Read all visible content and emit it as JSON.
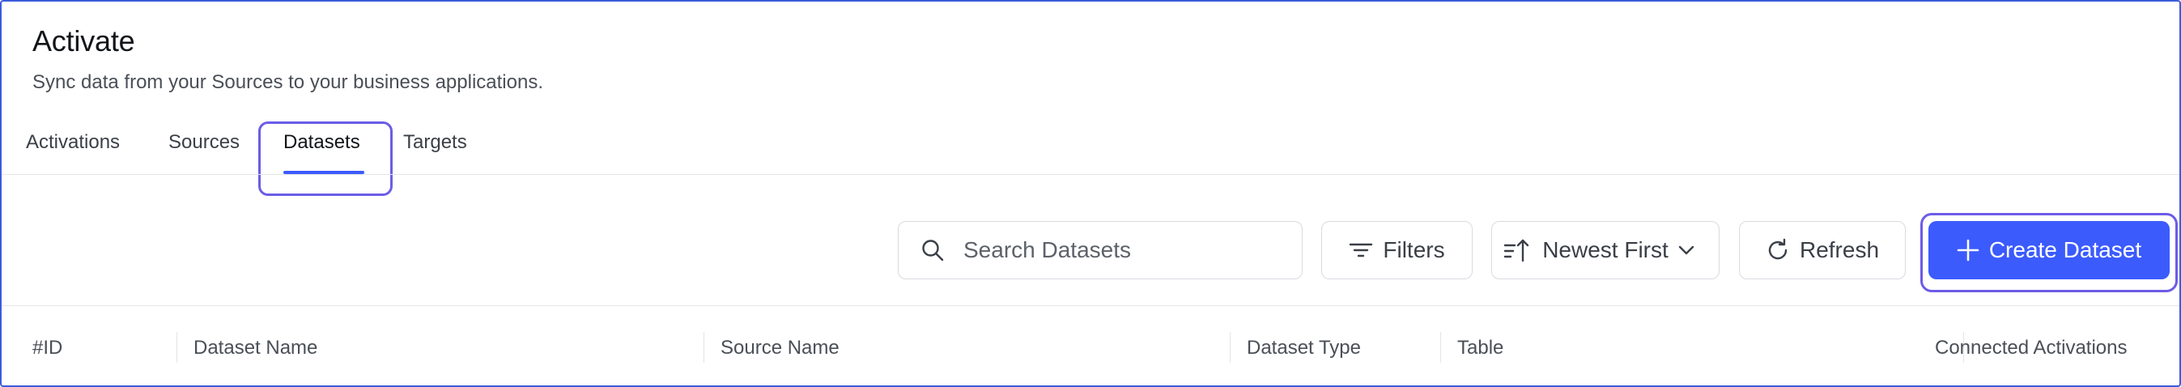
{
  "header": {
    "title": "Activate",
    "subtitle": "Sync data from your Sources to your business applications."
  },
  "tabs": [
    {
      "label": "Activations",
      "active": false
    },
    {
      "label": "Sources",
      "active": false
    },
    {
      "label": "Datasets",
      "active": true
    },
    {
      "label": "Targets",
      "active": false
    }
  ],
  "toolbar": {
    "search_placeholder": "Search Datasets",
    "filters_label": "Filters",
    "sort_label": "Newest First",
    "refresh_label": "Refresh",
    "create_label": "Create Dataset"
  },
  "table": {
    "columns": [
      "#ID",
      "Dataset Name",
      "Source Name",
      "Dataset Type",
      "Table",
      "Connected Activations"
    ]
  },
  "icons": {
    "search": "search-icon",
    "filters": "filter-lines-icon",
    "sort": "sort-arrow-icon",
    "chevron": "chevron-down-icon",
    "refresh": "refresh-icon",
    "create": "plus-icon"
  },
  "colors": {
    "accent": "#3b5bfd",
    "highlight": "#6c5ce7",
    "border": "#d8dbe0"
  }
}
